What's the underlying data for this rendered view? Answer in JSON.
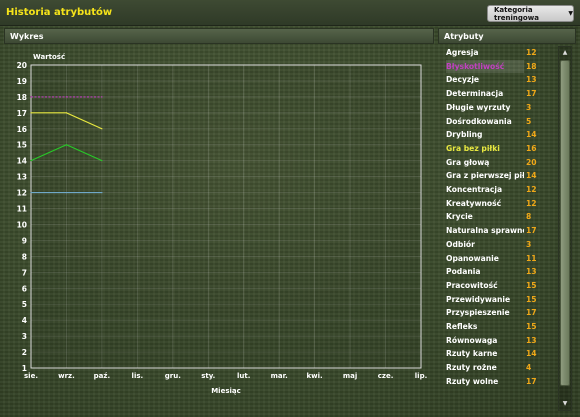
{
  "app": {
    "title": "Historia atrybutów"
  },
  "toolbar": {
    "category_label": "Kategoria treningowa"
  },
  "panels": {
    "chart_title": "Wykres",
    "attributes_title": "Atrybuty"
  },
  "colors": {
    "title_yellow": "#f5e31a",
    "value_orange": "#f0a818",
    "selected_purple": "#c040c0",
    "highlight_yellow": "#e8e840"
  },
  "chart_data": {
    "type": "line",
    "ylabel": "Wartość",
    "xlabel": "Miesiąc",
    "ylim": [
      1,
      20
    ],
    "yticks": [
      "20",
      "19",
      "18",
      "17",
      "16",
      "15",
      "14",
      "13",
      "12",
      "11",
      "10",
      "9",
      "8",
      "7",
      "6",
      "5",
      "4",
      "3",
      "2",
      "1"
    ],
    "categories": [
      "sie.",
      "wrz.",
      "paź.",
      "lis.",
      "gru.",
      "sty.",
      "lut.",
      "mar.",
      "kwi.",
      "maj",
      "cze.",
      "lip."
    ],
    "grid": true,
    "series": [
      {
        "color": "#e8e840",
        "style": "solid",
        "values": [
          17,
          17,
          16
        ]
      },
      {
        "color": "#c040c0",
        "style": "dashed",
        "values": [
          18,
          18,
          18
        ]
      },
      {
        "color": "#28c828",
        "style": "solid",
        "values": [
          14,
          15,
          14
        ]
      },
      {
        "color": "#6fa8c8",
        "style": "solid",
        "values": [
          12,
          12,
          12
        ]
      }
    ]
  },
  "attributes": [
    {
      "name": "Agresja",
      "value": "12",
      "color": "#ffffff",
      "hl": false
    },
    {
      "name": "Błyskotliwość",
      "value": "18",
      "color": "#c040c0",
      "hl": true
    },
    {
      "name": "Decyzje",
      "value": "13",
      "color": "#ffffff",
      "hl": false
    },
    {
      "name": "Determinacja",
      "value": "17",
      "color": "#ffffff",
      "hl": false
    },
    {
      "name": "Długie wyrzuty",
      "value": "3",
      "color": "#ffffff",
      "hl": false
    },
    {
      "name": "Dośrodkowania",
      "value": "5",
      "color": "#ffffff",
      "hl": false
    },
    {
      "name": "Drybling",
      "value": "14",
      "color": "#ffffff",
      "hl": false
    },
    {
      "name": "Gra bez piłki",
      "value": "16",
      "color": "#e8e840",
      "hl": false
    },
    {
      "name": "Gra głową",
      "value": "20",
      "color": "#ffffff",
      "hl": false
    },
    {
      "name": "Gra z pierwszej piłki",
      "value": "14",
      "color": "#ffffff",
      "hl": false
    },
    {
      "name": "Koncentracja",
      "value": "12",
      "color": "#ffffff",
      "hl": false
    },
    {
      "name": "Kreatywność",
      "value": "12",
      "color": "#ffffff",
      "hl": false
    },
    {
      "name": "Krycie",
      "value": "8",
      "color": "#ffffff",
      "hl": false
    },
    {
      "name": "Naturalna sprawność",
      "value": "17",
      "color": "#ffffff",
      "hl": false
    },
    {
      "name": "Odbiór",
      "value": "3",
      "color": "#ffffff",
      "hl": false
    },
    {
      "name": "Opanowanie",
      "value": "11",
      "color": "#ffffff",
      "hl": false
    },
    {
      "name": "Podania",
      "value": "13",
      "color": "#ffffff",
      "hl": false
    },
    {
      "name": "Pracowitość",
      "value": "15",
      "color": "#ffffff",
      "hl": false
    },
    {
      "name": "Przewidywanie",
      "value": "15",
      "color": "#ffffff",
      "hl": false
    },
    {
      "name": "Przyspieszenie",
      "value": "17",
      "color": "#ffffff",
      "hl": false
    },
    {
      "name": "Refleks",
      "value": "15",
      "color": "#ffffff",
      "hl": false
    },
    {
      "name": "Równowaga",
      "value": "13",
      "color": "#ffffff",
      "hl": false
    },
    {
      "name": "Rzuty karne",
      "value": "14",
      "color": "#ffffff",
      "hl": false
    },
    {
      "name": "Rzuty rożne",
      "value": "4",
      "color": "#ffffff",
      "hl": false
    },
    {
      "name": "Rzuty wolne",
      "value": "17",
      "color": "#ffffff",
      "hl": false
    }
  ],
  "scroll_icons": {
    "up": "scroll-up-arrow-icon",
    "down": "scroll-down-arrow-icon"
  }
}
